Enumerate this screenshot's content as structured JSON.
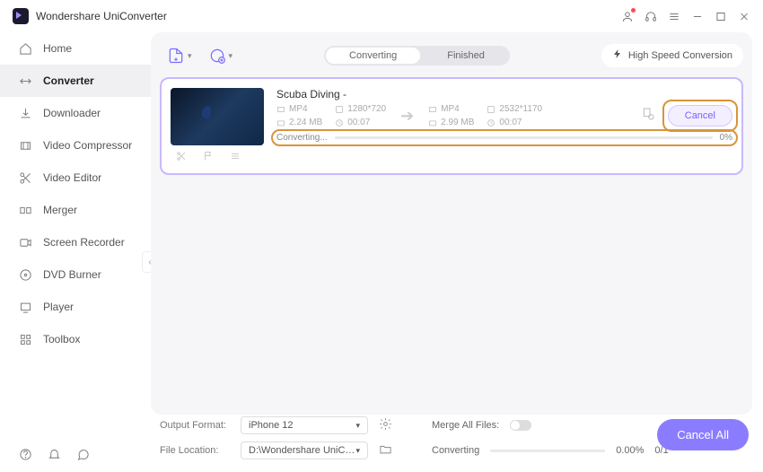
{
  "app": {
    "title": "Wondershare UniConverter"
  },
  "sidebar": {
    "items": [
      {
        "label": "Home"
      },
      {
        "label": "Converter"
      },
      {
        "label": "Downloader"
      },
      {
        "label": "Video Compressor"
      },
      {
        "label": "Video Editor"
      },
      {
        "label": "Merger"
      },
      {
        "label": "Screen Recorder"
      },
      {
        "label": "DVD Burner"
      },
      {
        "label": "Player"
      },
      {
        "label": "Toolbox"
      }
    ]
  },
  "toolbar": {
    "converting": "Converting",
    "finished": "Finished",
    "high_speed": "High Speed Conversion"
  },
  "card": {
    "title": "Scuba Diving -",
    "src": {
      "format": "MP4",
      "resolution": "1280*720",
      "size": "2.24 MB",
      "duration": "00:07"
    },
    "dst": {
      "format": "MP4",
      "resolution": "2532*1170",
      "size": "2.99 MB",
      "duration": "00:07"
    },
    "cancel": "Cancel",
    "status": "Converting...",
    "percent": "0%"
  },
  "footer": {
    "output_format_label": "Output Format:",
    "output_format_value": "iPhone 12",
    "file_location_label": "File Location:",
    "file_location_value": "D:\\Wondershare UniConverter",
    "merge_label": "Merge All Files:",
    "converting_label": "Converting",
    "converting_pct": "0.00%",
    "converting_count": "0/1",
    "cancel_all": "Cancel All"
  }
}
